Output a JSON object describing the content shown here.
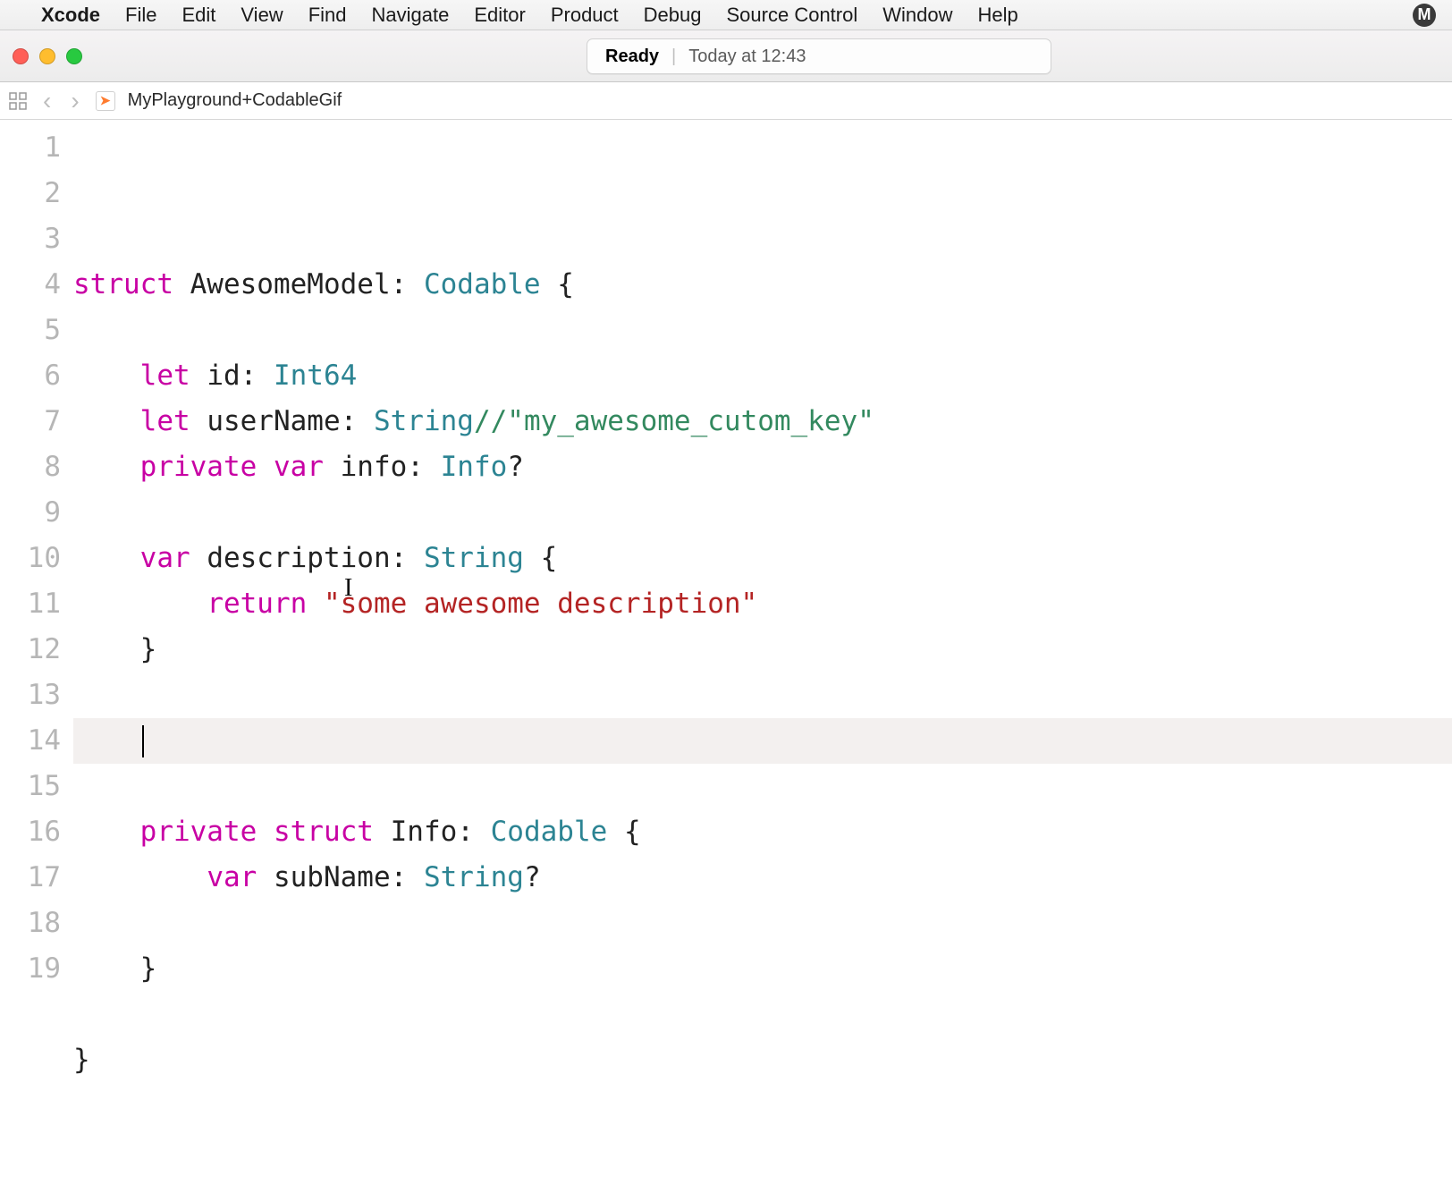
{
  "menubar": {
    "app": "Xcode",
    "items": [
      "File",
      "Edit",
      "View",
      "Find",
      "Navigate",
      "Editor",
      "Product",
      "Debug",
      "Source Control",
      "Window",
      "Help"
    ],
    "badge": "M"
  },
  "titlebar": {
    "status_label": "Ready",
    "status_time": "Today at 12:43"
  },
  "navbar": {
    "file": "MyPlayground+CodableGif"
  },
  "code": {
    "line_count": 19,
    "current_line": 11,
    "lines": [
      [
        {
          "k": "struct"
        },
        {
          "p": " AwesomeModel: "
        },
        {
          "t": "Codable"
        },
        {
          "p": " {"
        }
      ],
      [],
      [
        {
          "p": "    "
        },
        {
          "k": "let"
        },
        {
          "p": " id: "
        },
        {
          "t": "Int64"
        }
      ],
      [
        {
          "p": "    "
        },
        {
          "k": "let"
        },
        {
          "p": " userName: "
        },
        {
          "t": "String"
        },
        {
          "c": "//\"my_awesome_cutom_key\""
        }
      ],
      [
        {
          "p": "    "
        },
        {
          "k": "private"
        },
        {
          "p": " "
        },
        {
          "k": "var"
        },
        {
          "p": " info: "
        },
        {
          "t": "Info"
        },
        {
          "p": "?"
        }
      ],
      [],
      [
        {
          "p": "    "
        },
        {
          "k": "var"
        },
        {
          "p": " description: "
        },
        {
          "t": "String"
        },
        {
          "p": " {"
        }
      ],
      [
        {
          "p": "        "
        },
        {
          "k": "return"
        },
        {
          "p": " "
        },
        {
          "s": "\"some awesome description\""
        }
      ],
      [
        {
          "p": "    }"
        }
      ],
      [],
      [
        {
          "p": "    "
        }
      ],
      [],
      [
        {
          "p": "    "
        },
        {
          "k": "private"
        },
        {
          "p": " "
        },
        {
          "k": "struct"
        },
        {
          "p": " Info: "
        },
        {
          "t": "Codable"
        },
        {
          "p": " {"
        }
      ],
      [
        {
          "p": "        "
        },
        {
          "k": "var"
        },
        {
          "p": " subName: "
        },
        {
          "t": "String"
        },
        {
          "p": "?"
        }
      ],
      [],
      [
        {
          "p": "    }"
        }
      ],
      [],
      [
        {
          "p": "}"
        }
      ],
      []
    ]
  }
}
